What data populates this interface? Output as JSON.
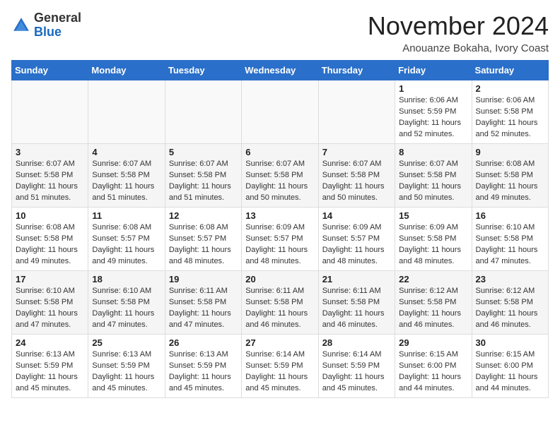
{
  "header": {
    "logo_line1": "General",
    "logo_line2": "Blue",
    "month": "November 2024",
    "location": "Anouanze Bokaha, Ivory Coast"
  },
  "weekdays": [
    "Sunday",
    "Monday",
    "Tuesday",
    "Wednesday",
    "Thursday",
    "Friday",
    "Saturday"
  ],
  "weeks": [
    [
      {
        "day": "",
        "info": ""
      },
      {
        "day": "",
        "info": ""
      },
      {
        "day": "",
        "info": ""
      },
      {
        "day": "",
        "info": ""
      },
      {
        "day": "",
        "info": ""
      },
      {
        "day": "1",
        "info": "Sunrise: 6:06 AM\nSunset: 5:59 PM\nDaylight: 11 hours\nand 52 minutes."
      },
      {
        "day": "2",
        "info": "Sunrise: 6:06 AM\nSunset: 5:58 PM\nDaylight: 11 hours\nand 52 minutes."
      }
    ],
    [
      {
        "day": "3",
        "info": "Sunrise: 6:07 AM\nSunset: 5:58 PM\nDaylight: 11 hours\nand 51 minutes."
      },
      {
        "day": "4",
        "info": "Sunrise: 6:07 AM\nSunset: 5:58 PM\nDaylight: 11 hours\nand 51 minutes."
      },
      {
        "day": "5",
        "info": "Sunrise: 6:07 AM\nSunset: 5:58 PM\nDaylight: 11 hours\nand 51 minutes."
      },
      {
        "day": "6",
        "info": "Sunrise: 6:07 AM\nSunset: 5:58 PM\nDaylight: 11 hours\nand 50 minutes."
      },
      {
        "day": "7",
        "info": "Sunrise: 6:07 AM\nSunset: 5:58 PM\nDaylight: 11 hours\nand 50 minutes."
      },
      {
        "day": "8",
        "info": "Sunrise: 6:07 AM\nSunset: 5:58 PM\nDaylight: 11 hours\nand 50 minutes."
      },
      {
        "day": "9",
        "info": "Sunrise: 6:08 AM\nSunset: 5:58 PM\nDaylight: 11 hours\nand 49 minutes."
      }
    ],
    [
      {
        "day": "10",
        "info": "Sunrise: 6:08 AM\nSunset: 5:58 PM\nDaylight: 11 hours\nand 49 minutes."
      },
      {
        "day": "11",
        "info": "Sunrise: 6:08 AM\nSunset: 5:57 PM\nDaylight: 11 hours\nand 49 minutes."
      },
      {
        "day": "12",
        "info": "Sunrise: 6:08 AM\nSunset: 5:57 PM\nDaylight: 11 hours\nand 48 minutes."
      },
      {
        "day": "13",
        "info": "Sunrise: 6:09 AM\nSunset: 5:57 PM\nDaylight: 11 hours\nand 48 minutes."
      },
      {
        "day": "14",
        "info": "Sunrise: 6:09 AM\nSunset: 5:57 PM\nDaylight: 11 hours\nand 48 minutes."
      },
      {
        "day": "15",
        "info": "Sunrise: 6:09 AM\nSunset: 5:58 PM\nDaylight: 11 hours\nand 48 minutes."
      },
      {
        "day": "16",
        "info": "Sunrise: 6:10 AM\nSunset: 5:58 PM\nDaylight: 11 hours\nand 47 minutes."
      }
    ],
    [
      {
        "day": "17",
        "info": "Sunrise: 6:10 AM\nSunset: 5:58 PM\nDaylight: 11 hours\nand 47 minutes."
      },
      {
        "day": "18",
        "info": "Sunrise: 6:10 AM\nSunset: 5:58 PM\nDaylight: 11 hours\nand 47 minutes."
      },
      {
        "day": "19",
        "info": "Sunrise: 6:11 AM\nSunset: 5:58 PM\nDaylight: 11 hours\nand 47 minutes."
      },
      {
        "day": "20",
        "info": "Sunrise: 6:11 AM\nSunset: 5:58 PM\nDaylight: 11 hours\nand 46 minutes."
      },
      {
        "day": "21",
        "info": "Sunrise: 6:11 AM\nSunset: 5:58 PM\nDaylight: 11 hours\nand 46 minutes."
      },
      {
        "day": "22",
        "info": "Sunrise: 6:12 AM\nSunset: 5:58 PM\nDaylight: 11 hours\nand 46 minutes."
      },
      {
        "day": "23",
        "info": "Sunrise: 6:12 AM\nSunset: 5:58 PM\nDaylight: 11 hours\nand 46 minutes."
      }
    ],
    [
      {
        "day": "24",
        "info": "Sunrise: 6:13 AM\nSunset: 5:59 PM\nDaylight: 11 hours\nand 45 minutes."
      },
      {
        "day": "25",
        "info": "Sunrise: 6:13 AM\nSunset: 5:59 PM\nDaylight: 11 hours\nand 45 minutes."
      },
      {
        "day": "26",
        "info": "Sunrise: 6:13 AM\nSunset: 5:59 PM\nDaylight: 11 hours\nand 45 minutes."
      },
      {
        "day": "27",
        "info": "Sunrise: 6:14 AM\nSunset: 5:59 PM\nDaylight: 11 hours\nand 45 minutes."
      },
      {
        "day": "28",
        "info": "Sunrise: 6:14 AM\nSunset: 5:59 PM\nDaylight: 11 hours\nand 45 minutes."
      },
      {
        "day": "29",
        "info": "Sunrise: 6:15 AM\nSunset: 6:00 PM\nDaylight: 11 hours\nand 44 minutes."
      },
      {
        "day": "30",
        "info": "Sunrise: 6:15 AM\nSunset: 6:00 PM\nDaylight: 11 hours\nand 44 minutes."
      }
    ]
  ]
}
